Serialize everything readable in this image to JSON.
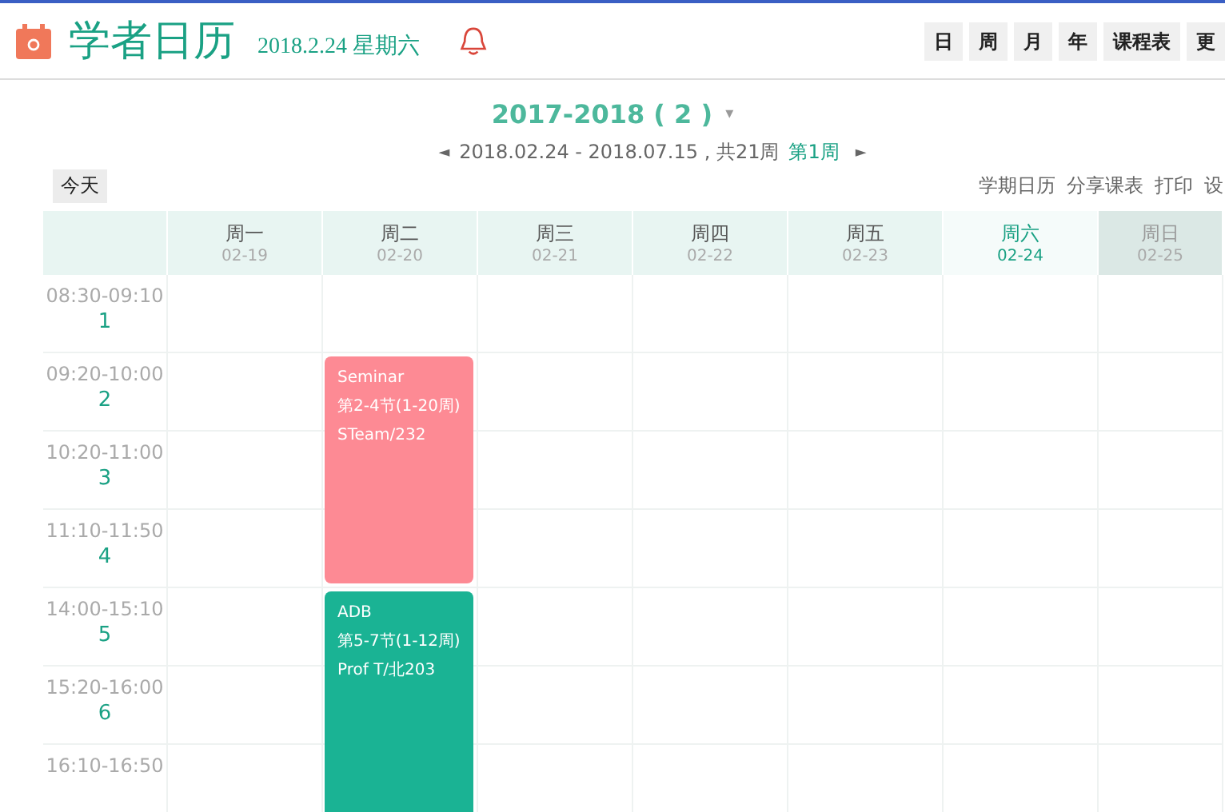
{
  "header": {
    "title": "学者日历",
    "date": "2018.2.24 星期六",
    "views": [
      "日",
      "周",
      "月",
      "年",
      "课程表",
      "更"
    ]
  },
  "term": {
    "title": "2017-2018 ( 2 )",
    "caret": "▾",
    "prev": "◄",
    "range": "2018.02.24 - 2018.07.15 , 共21周",
    "week": "第1周",
    "next": "►"
  },
  "today_button": "今天",
  "links": [
    "学期日历",
    "分享课表",
    "打印",
    "设"
  ],
  "days": [
    {
      "name": "周一",
      "date": "02-19",
      "selected": false,
      "dimmed": false
    },
    {
      "name": "周二",
      "date": "02-20",
      "selected": false,
      "dimmed": false,
      "cells": [
        {
          "kind": "empty"
        },
        {
          "kind": "course",
          "title": "Seminar",
          "sessions": "第2-4节(1-20周)",
          "location": "STeam/232",
          "color": "#fd8a94"
        },
        {
          "kind": "continued"
        },
        {
          "kind": "continued"
        },
        {
          "kind": "course",
          "title": "ADB",
          "sessions": "第5-7节(1-12周)",
          "location": "Prof T/北203",
          "color": "#1ab394"
        },
        {
          "kind": "continued"
        },
        {
          "kind": "continued"
        }
      ]
    },
    {
      "name": "周三",
      "date": "02-21",
      "selected": false,
      "dimmed": false
    },
    {
      "name": "周四",
      "date": "02-22",
      "selected": false,
      "dimmed": false
    },
    {
      "name": "周五",
      "date": "02-23",
      "selected": false,
      "dimmed": false
    },
    {
      "name": "周六",
      "date": "02-24",
      "selected": true,
      "dimmed": false
    },
    {
      "name": "周日",
      "date": "02-25",
      "selected": false,
      "dimmed": true
    }
  ],
  "periods": [
    {
      "time": "08:30-09:10",
      "number": "1"
    },
    {
      "time": "09:20-10:00",
      "number": "2"
    },
    {
      "time": "10:20-11:00",
      "number": "3"
    },
    {
      "time": "11:10-11:50",
      "number": "4"
    },
    {
      "time": "14:00-15:10",
      "number": "5"
    },
    {
      "time": "15:20-16:00",
      "number": "6"
    },
    {
      "time": "16:10-16:50"
    }
  ]
}
